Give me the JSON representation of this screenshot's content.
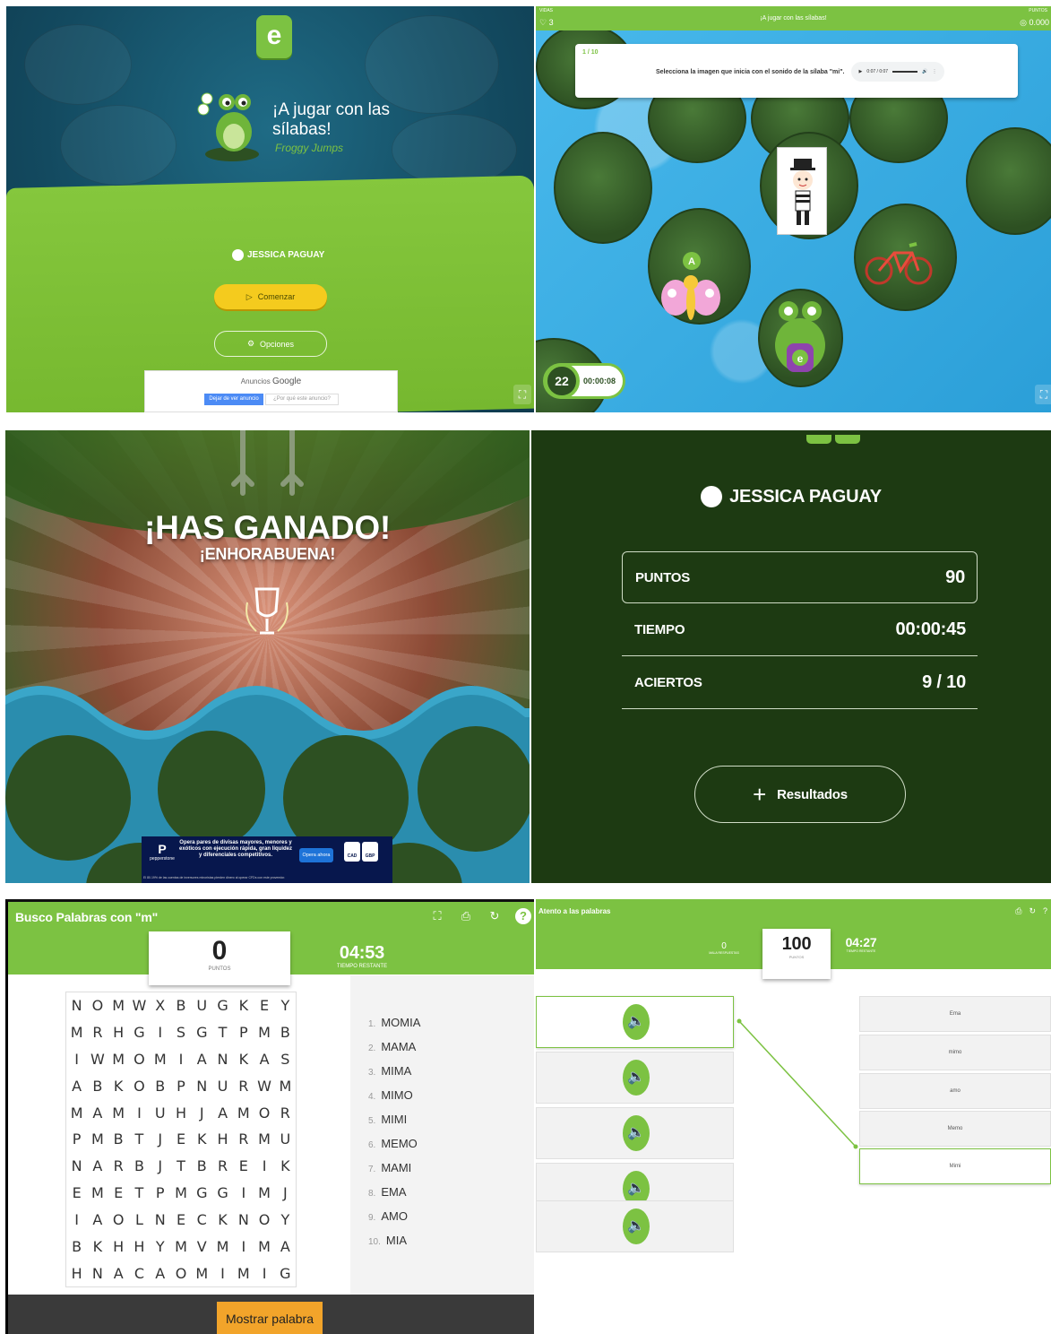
{
  "intro": {
    "logo_letter": "e",
    "title": "¡A jugar con las sílabas!",
    "subtitle": "Froggy Jumps",
    "user_name": "JESSICA PAGUAY",
    "start_label": "Comenzar",
    "options_label": "Opciones",
    "ad_label": "Anuncios",
    "ad_brand": "Google",
    "ad_stop_label": "Dejar de ver anuncio",
    "ad_why_label": "¿Por qué este anuncio?",
    "colors": {
      "accent": "#7cc242",
      "start_button": "#f4cb1e"
    }
  },
  "game": {
    "lives_label": "VIDAS",
    "lives": "♡ 3",
    "title": "¡A jugar con las sílabas!",
    "score_label": "PUNTOS",
    "score": "◎ 0.000",
    "question_number": "1 / 10",
    "question_text": "Selecciona la imagen que inicia con el sonido de la sílaba \"mi\".",
    "audio_time": "0:07 / 0:07",
    "option_letter": "A",
    "frog_letter": "e",
    "timer_seconds": "22",
    "timer_clock": "00:00:08",
    "icons": [
      "heart-icon",
      "score-icon",
      "play-icon",
      "volume-icon",
      "more-icon",
      "fullscreen-icon"
    ]
  },
  "win": {
    "headline": "¡HAS GANADO!",
    "subheadline": "¡ENHORABUENA!",
    "ad_brand": "pepperstone",
    "ad_text": "Opera pares de divisas mayores, menores y exóticos con ejecución rápida, gran liquidez y diferenciales competitivos.",
    "ad_cta": "Opera ahora",
    "ad_flag_1": "CAD",
    "ad_flag_2": "GBP",
    "ad_disclaimer": "El 80.19% de las cuentas de inversores minoristas pierden dinero al operar CFDs con este proveedor."
  },
  "results": {
    "user_name": "JESSICA PAGUAY",
    "rows": [
      {
        "label": "PUNTOS",
        "value": "90"
      },
      {
        "label": "TIEMPO",
        "value": "00:00:45"
      },
      {
        "label": "ACIERTOS",
        "value": "9 / 10"
      }
    ],
    "results_button": "Resultados"
  },
  "wordsearch": {
    "title": "Busco Palabras con \"m\"",
    "score": "0",
    "score_label": "PUNTOS",
    "time": "04:53",
    "time_label": "TIEMPO RESTANTE",
    "grid": [
      [
        "N",
        "O",
        "M",
        "W",
        "X",
        "B",
        "U",
        "G",
        "K",
        "E",
        "Y"
      ],
      [
        "M",
        "R",
        "H",
        "G",
        "I",
        "S",
        "G",
        "T",
        "P",
        "M",
        "B"
      ],
      [
        "I",
        "W",
        "M",
        "O",
        "M",
        "I",
        "A",
        "N",
        "K",
        "A",
        "S"
      ],
      [
        "A",
        "B",
        "K",
        "O",
        "B",
        "P",
        "N",
        "U",
        "R",
        "W",
        "M"
      ],
      [
        "M",
        "A",
        "M",
        "I",
        "U",
        "H",
        "J",
        "A",
        "M",
        "O",
        "R"
      ],
      [
        "P",
        "M",
        "B",
        "T",
        "J",
        "E",
        "K",
        "H",
        "R",
        "M",
        "U"
      ],
      [
        "N",
        "A",
        "R",
        "B",
        "J",
        "T",
        "B",
        "R",
        "E",
        "I",
        "K"
      ],
      [
        "E",
        "M",
        "E",
        "T",
        "P",
        "M",
        "G",
        "G",
        "I",
        "M",
        "J"
      ],
      [
        "I",
        "A",
        "O",
        "L",
        "N",
        "E",
        "C",
        "K",
        "N",
        "O",
        "Y"
      ],
      [
        "B",
        "K",
        "H",
        "H",
        "Y",
        "M",
        "V",
        "M",
        "I",
        "M",
        "A"
      ],
      [
        "H",
        "N",
        "A",
        "C",
        "A",
        "O",
        "M",
        "I",
        "M",
        "I",
        "G"
      ]
    ],
    "words": [
      {
        "num": "1.",
        "word": "MOMIA"
      },
      {
        "num": "2.",
        "word": "MAMA"
      },
      {
        "num": "3.",
        "word": "MIMA"
      },
      {
        "num": "4.",
        "word": "MIMO"
      },
      {
        "num": "5.",
        "word": "MIMI"
      },
      {
        "num": "6.",
        "word": "MEMO"
      },
      {
        "num": "7.",
        "word": "MAMI"
      },
      {
        "num": "8.",
        "word": "EMA"
      },
      {
        "num": "9.",
        "word": "AMO"
      },
      {
        "num": "10.",
        "word": "MIA"
      }
    ],
    "show_word_button": "Mostrar palabra",
    "icons": [
      "fullscreen-icon",
      "print-icon",
      "reload-icon",
      "help-icon"
    ]
  },
  "match": {
    "title": "Atento a las palabras",
    "mistakes": "0",
    "mistakes_label": "MALA RESPUESTAS",
    "score": "100",
    "score_label": "PUNTOS",
    "time": "04:27",
    "time_label": "TIEMPO RESTANTE",
    "words": [
      "Ema",
      "mimo",
      "amo",
      "Memo",
      "Mimi"
    ]
  }
}
